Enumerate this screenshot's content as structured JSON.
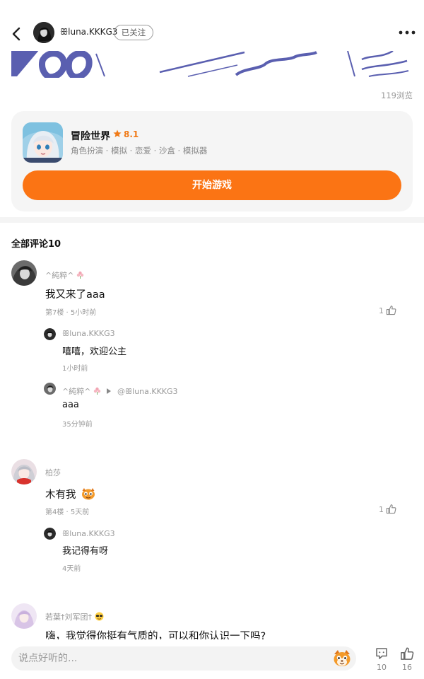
{
  "header": {
    "username": "ꕥluna.KKKG3",
    "follow_label": "已关注"
  },
  "post": {
    "view_count": "119浏览"
  },
  "game": {
    "title": "冒险世界",
    "rating": "8.1",
    "tags": "角色扮演 · 模拟 · 恋爱 · 沙盒 · 模拟器",
    "play_label": "开始游戏"
  },
  "comments_section": {
    "title": "全部评论10"
  },
  "comments": [
    {
      "user": "^純粹^",
      "text": "我又来了aaa",
      "floor": "第7楼",
      "time": "5小时前",
      "likes": "1",
      "replies": [
        {
          "user": "ꕥluna.KKKG3",
          "text": "嘻嘻，欢迎公主",
          "time": "1小时前"
        },
        {
          "user": "^純粹^",
          "reply_to": "@ꕥluna.KKKG3",
          "text": "aaa",
          "time": "35分钟前"
        }
      ]
    },
    {
      "user": "柏莎",
      "text": "木有我",
      "floor": "第4楼",
      "time": "5天前",
      "likes": "1",
      "replies": [
        {
          "user": "ꕥluna.KKKG3",
          "text": "我记得有呀",
          "time": "4天前"
        }
      ]
    },
    {
      "user": "若葉†刘军团†",
      "text": "嗨，我觉得你挺有气质的，可以和你认识一下吗?"
    }
  ],
  "bottom_bar": {
    "placeholder": "说点好听的...",
    "comment_count": "10",
    "like_count": "16"
  },
  "colors": {
    "accent": "#fb7414",
    "rating": "#f07a17",
    "muted": "#999999"
  }
}
